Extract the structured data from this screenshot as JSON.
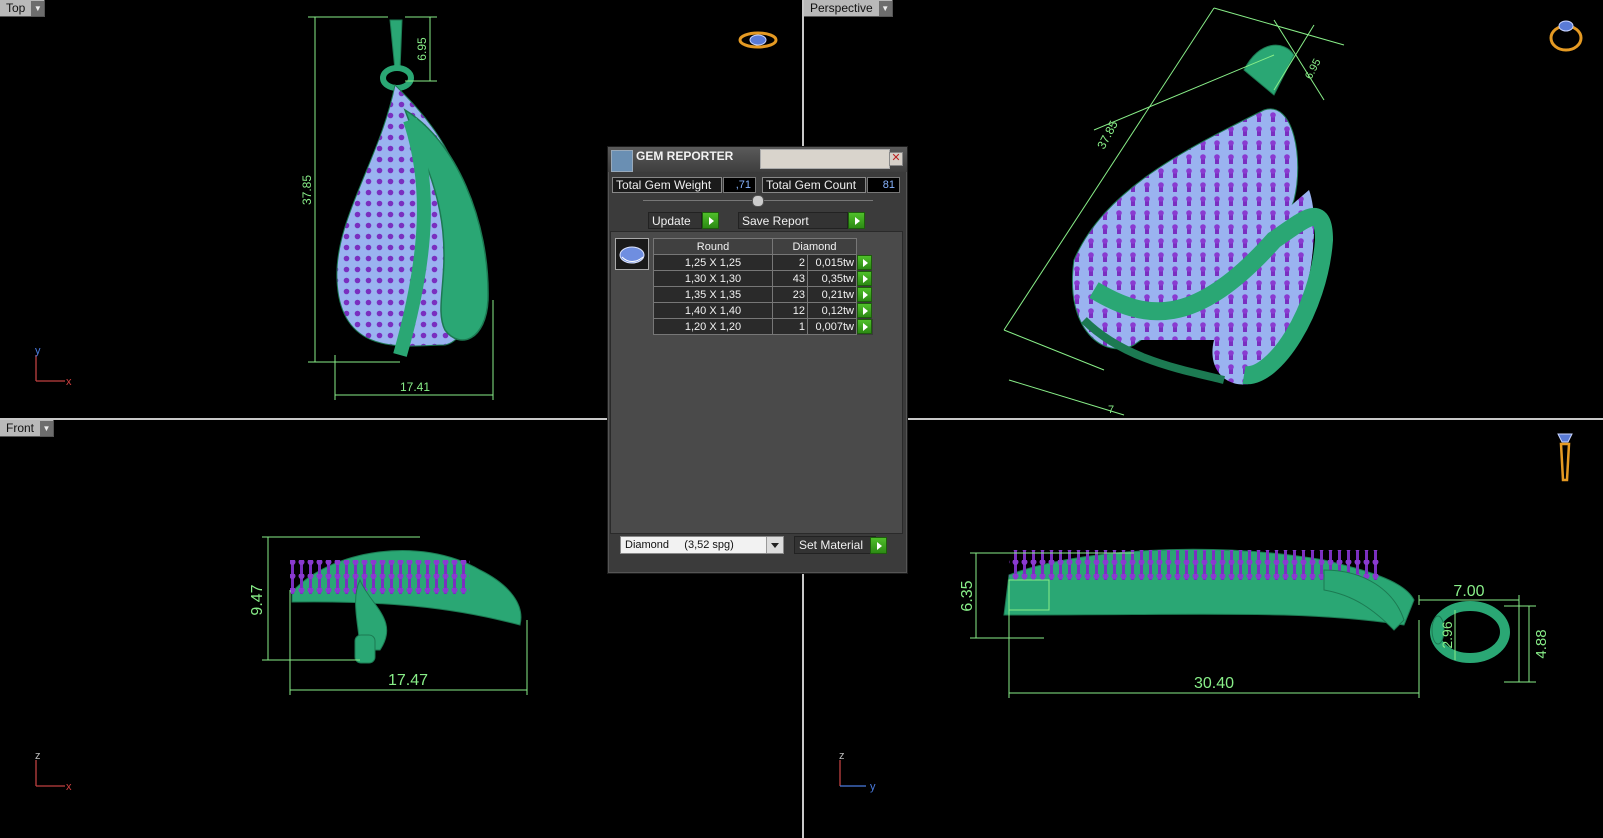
{
  "viewports": {
    "top": {
      "label": "Top",
      "dim_height": "37.85",
      "dim_width": "17.41",
      "dim_bail": "6.95",
      "axis_v": "y",
      "axis_h": "x"
    },
    "perspective": {
      "label": "Perspective",
      "dim_a": "37.85",
      "dim_b": "6.95",
      "dim_c": "7"
    },
    "front": {
      "label": "Front",
      "dim_height": "9.47",
      "dim_width": "17.47",
      "axis_v": "z",
      "axis_h": "x"
    },
    "side": {
      "dim_height": "6.35",
      "dim_length": "30.40",
      "dim_bail_w": "7.00",
      "dim_bail_h": "4.88",
      "dim_bail_inner": "2.96",
      "axis_v": "z",
      "axis_h": "y"
    }
  },
  "gem_reporter": {
    "title": "GEM REPORTER",
    "total_weight_label": "Total Gem Weight",
    "total_weight_value": ",71",
    "total_count_label": "Total Gem Count",
    "total_count_value": "81",
    "update_label": "Update",
    "save_report_label": "Save Report",
    "table_header": {
      "shape": "Round",
      "material": "Diamond"
    },
    "rows": [
      {
        "size": "1,25 X 1,25",
        "count": "2",
        "weight": "0,015tw"
      },
      {
        "size": "1,30 X 1,30",
        "count": "43",
        "weight": "0,35tw"
      },
      {
        "size": "1,35 X 1,35",
        "count": "23",
        "weight": "0,21tw"
      },
      {
        "size": "1,40 X 1,40",
        "count": "12",
        "weight": "0,12tw"
      },
      {
        "size": "1,20 X 1,20",
        "count": "1",
        "weight": "0,007tw"
      }
    ],
    "material_select": "Diamond     (3,52 spg)",
    "set_material_label": "Set Material"
  },
  "colors": {
    "dimension": "#88ee88",
    "metal": "#2aa774",
    "gem": "#9ab3f0",
    "prong": "#7a2fc0"
  }
}
